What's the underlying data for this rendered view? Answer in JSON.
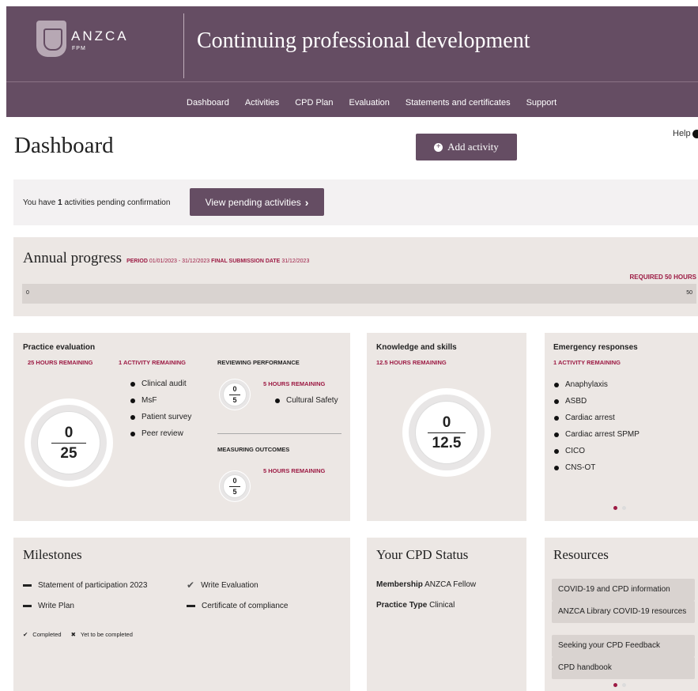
{
  "header": {
    "brand": "ANZCA",
    "brand_sub": "FPM",
    "title": "Continuing professional development",
    "nav": [
      "Dashboard",
      "Activities",
      "CPD Plan",
      "Evaluation",
      "Statements and certificates",
      "Support"
    ]
  },
  "page": {
    "title": "Dashboard",
    "help": "Help",
    "add_activity": "Add activity"
  },
  "pending": {
    "prefix": "You have ",
    "count": "1",
    "suffix": " activities pending confirmation",
    "button": "View pending activities"
  },
  "annual": {
    "title": "Annual progress",
    "period_label": "PERIOD",
    "period_value": "01/01/2023 - 31/12/2023",
    "final_label": "FINAL SUBMISSION DATE",
    "final_value": "31/12/2023",
    "required": "REQUIRED 50 HOURS",
    "start": "0",
    "end": "50",
    "progress_fraction": 0
  },
  "practice": {
    "title": "Practice evaluation",
    "hours_remaining": "25 HOURS REMAINING",
    "activity_remaining": "1 ACTIVITY REMAINING",
    "done": "0",
    "total": "25",
    "items": [
      "Clinical audit",
      "MsF",
      "Patient survey",
      "Peer review"
    ],
    "reviewing": {
      "label": "REVIEWING PERFORMANCE",
      "remaining": "5 HOURS REMAINING",
      "done": "0",
      "total": "5",
      "items": [
        "Cultural Safety"
      ]
    },
    "measuring": {
      "label": "MEASURING OUTCOMES",
      "remaining": "5 HOURS REMAINING",
      "done": "0",
      "total": "5"
    }
  },
  "knowledge": {
    "title": "Knowledge and skills",
    "remaining": "12.5 HOURS REMAINING",
    "done": "0",
    "total": "12.5"
  },
  "emergency": {
    "title": "Emergency responses",
    "remaining": "1 ACTIVITY REMAINING",
    "items": [
      "Anaphylaxis",
      "ASBD",
      "Cardiac arrest",
      "Cardiac arrest SPMP",
      "CICO",
      "CNS-OT"
    ]
  },
  "milestones": {
    "title": "Milestones",
    "items": [
      {
        "label": "Statement of participation 2023",
        "status": "pending"
      },
      {
        "label": "Write Evaluation",
        "status": "completed"
      },
      {
        "label": "Write Plan",
        "status": "pending"
      },
      {
        "label": "Certificate of compliance",
        "status": "pending"
      }
    ],
    "legend_completed": "Completed",
    "legend_pending": "Yet to be completed"
  },
  "cpd_status": {
    "title": "Your CPD Status",
    "membership_label": "Membership",
    "membership_value": "ANZCA Fellow",
    "practice_label": "Practice Type",
    "practice_value": "Clinical"
  },
  "resources": {
    "title": "Resources",
    "items": [
      "COVID-19 and CPD information",
      "ANZCA Library COVID-19 resources",
      "Seeking your CPD Feedback",
      "CPD handbook"
    ]
  },
  "colors": {
    "brand": "#654d63",
    "accent_red": "#9c1a43",
    "card_bg": "#ece7e4"
  }
}
